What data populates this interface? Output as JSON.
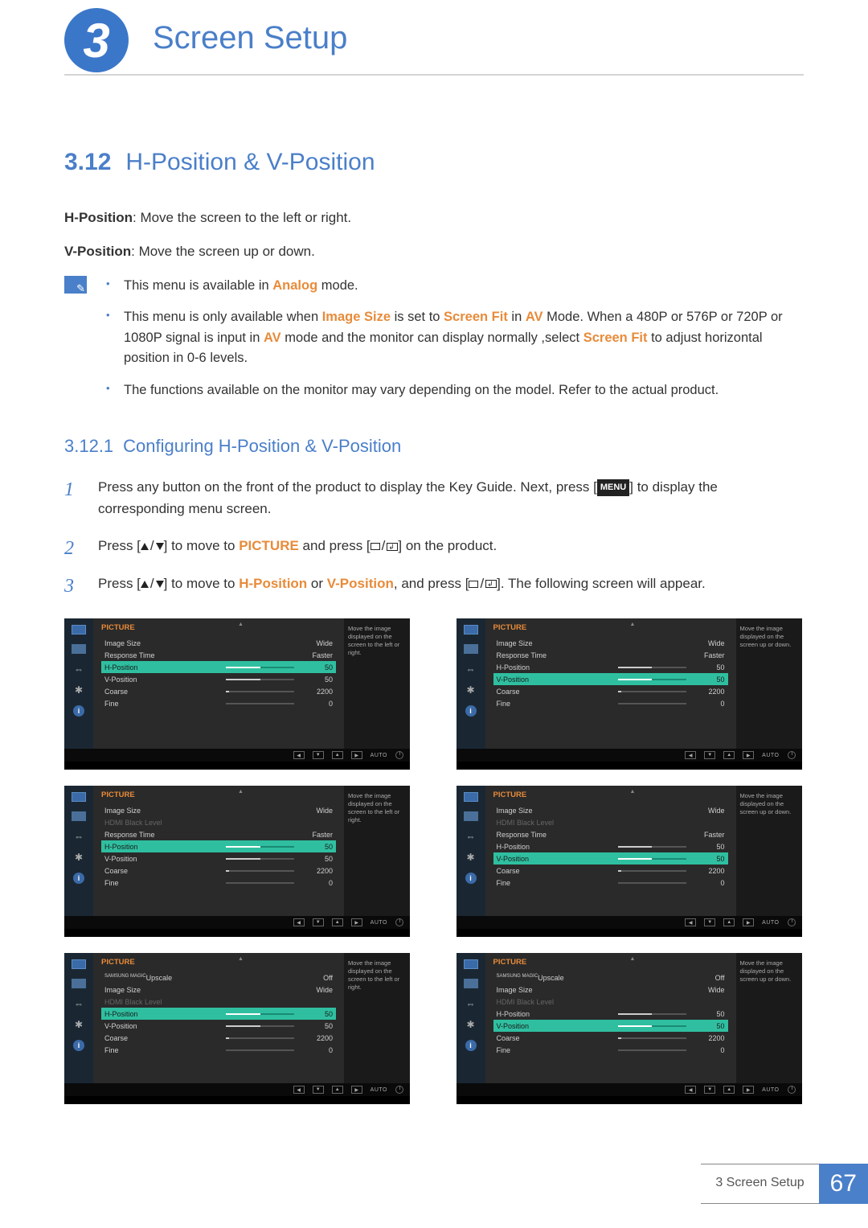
{
  "chapter_num": "3",
  "chapter_title": "Screen Setup",
  "section": {
    "num": "3.12",
    "title": "H-Position & V-Position"
  },
  "intro": {
    "h_label": "H-Position",
    "h_text": ": Move the screen to the left or right.",
    "v_label": "V-Position",
    "v_text": ": Move the screen up or down."
  },
  "notes": {
    "b1_pre": "This menu is available in ",
    "b1_accent": "Analog",
    "b1_post": " mode.",
    "b2_p1": "This menu is only available when ",
    "b2_a1": "Image Size",
    "b2_p2": " is set to ",
    "b2_a2": "Screen Fit",
    "b2_p3": " in ",
    "b2_a3": "AV",
    "b2_p4": " Mode. When a 480P or 576P or 720P or 1080P signal is input in ",
    "b2_a4": "AV",
    "b2_p5": " mode and the monitor can display normally ,select ",
    "b2_a5": "Screen Fit",
    "b2_p6": " to adjust horizontal position in 0-6 levels.",
    "b3": "The functions available on the monitor may vary depending on the model. Refer to the actual product."
  },
  "subsection": {
    "num": "3.12.1",
    "title": "Configuring H-Position & V-Position"
  },
  "steps": {
    "s1_a": "Press any button on the front of the product to display the Key Guide. Next, press [",
    "s1_key": "MENU",
    "s1_b": "] to display the corresponding menu screen.",
    "s2_a": "Press [",
    "s2_b": "] to move to ",
    "s2_accent": "PICTURE",
    "s2_c": " and press [",
    "s2_d": "] on the product.",
    "s3_a": "Press [",
    "s3_b": "] to move to ",
    "s3_accent1": "H-Position",
    "s3_or": " or ",
    "s3_accent2": "V-Position",
    "s3_c": ", and press [",
    "s3_d": "]. The following screen will appear."
  },
  "osd_common": {
    "title": "PICTURE",
    "tip_h": "Move the image displayed on the screen to the left or right.",
    "tip_v": "Move the image displayed on the screen up or down.",
    "foot_auto": "AUTO",
    "labels": {
      "image_size": "Image Size",
      "response_time": "Response Time",
      "h_position": "H-Position",
      "v_position": "V-Position",
      "coarse": "Coarse",
      "fine": "Fine",
      "hdmi_black": "HDMI Black Level",
      "upscale": "Upscale",
      "upscale_brand": "SAMSUNG MAGIC"
    },
    "values": {
      "wide": "Wide",
      "faster": "Faster",
      "off": "Off",
      "n50": "50",
      "n2200": "2200",
      "n0": "0"
    }
  },
  "footer": {
    "label": "3 Screen Setup",
    "page": "67"
  }
}
